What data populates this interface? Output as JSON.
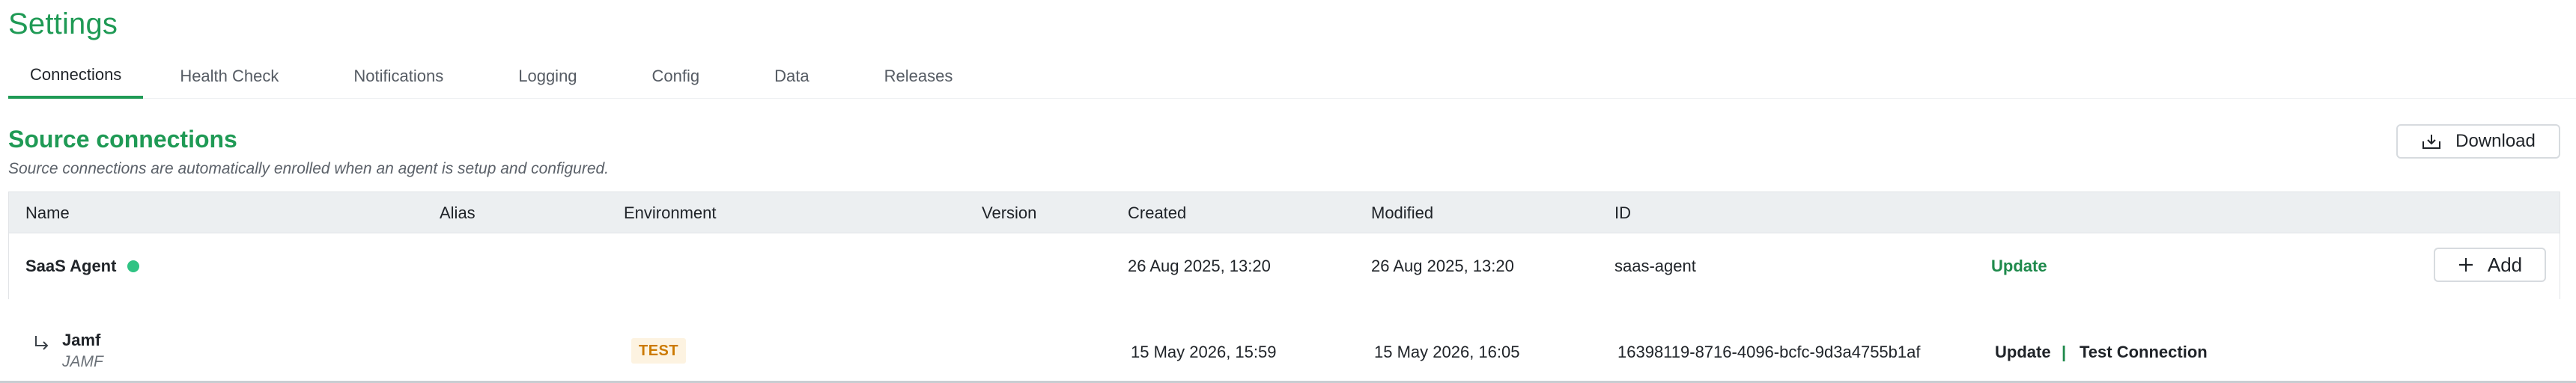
{
  "page": {
    "title": "Settings"
  },
  "tabs": [
    {
      "label": "Connections",
      "active": true
    },
    {
      "label": "Health Check",
      "active": false
    },
    {
      "label": "Notifications",
      "active": false
    },
    {
      "label": "Logging",
      "active": false
    },
    {
      "label": "Config",
      "active": false
    },
    {
      "label": "Data",
      "active": false
    },
    {
      "label": "Releases",
      "active": false
    }
  ],
  "section": {
    "title": "Source connections",
    "subtitle": "Source connections are automatically enrolled when an agent is setup and configured.",
    "download_label": "Download"
  },
  "table": {
    "columns": [
      "Name",
      "Alias",
      "Environment",
      "Version",
      "Created",
      "Modified",
      "ID"
    ],
    "rows": [
      {
        "name": "SaaS Agent",
        "status_color": "#2fc383",
        "alias": "",
        "environment": "",
        "version": "",
        "created": "26 Aug 2025, 13:20",
        "modified": "26 Aug 2025, 13:20",
        "id": "saas-agent",
        "action": "Update",
        "add_label": "Add"
      }
    ],
    "child_rows": [
      {
        "name": "Jamf",
        "type": "JAMF",
        "environment_badge": "TEST",
        "created": "15 May 2026, 15:59",
        "modified": "15 May 2026, 16:05",
        "id": "16398119-8716-4096-bcfc-9d3a4755b1af",
        "update_label": "Update",
        "separator": "|",
        "test_label": "Test Connection"
      }
    ]
  },
  "colors": {
    "accent": "#1f9a55",
    "link": "#1f8a4c",
    "badge_bg": "#fdf3e1",
    "badge_text": "#cc7a00",
    "header_bg": "#eceff1"
  },
  "icons": {
    "download": "download-tray-icon",
    "add": "plus-icon",
    "child": "corner-down-right-icon"
  }
}
